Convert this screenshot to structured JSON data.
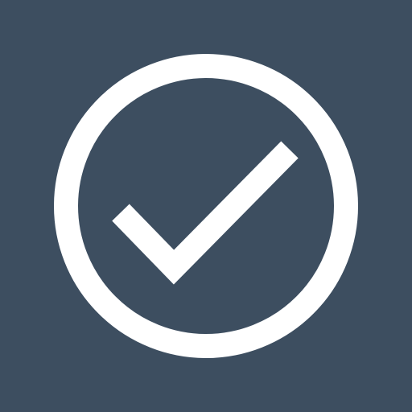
{
  "icon": {
    "name": "check-circle-icon",
    "background_color": "#3d4e60",
    "foreground_color": "#ffffff"
  }
}
